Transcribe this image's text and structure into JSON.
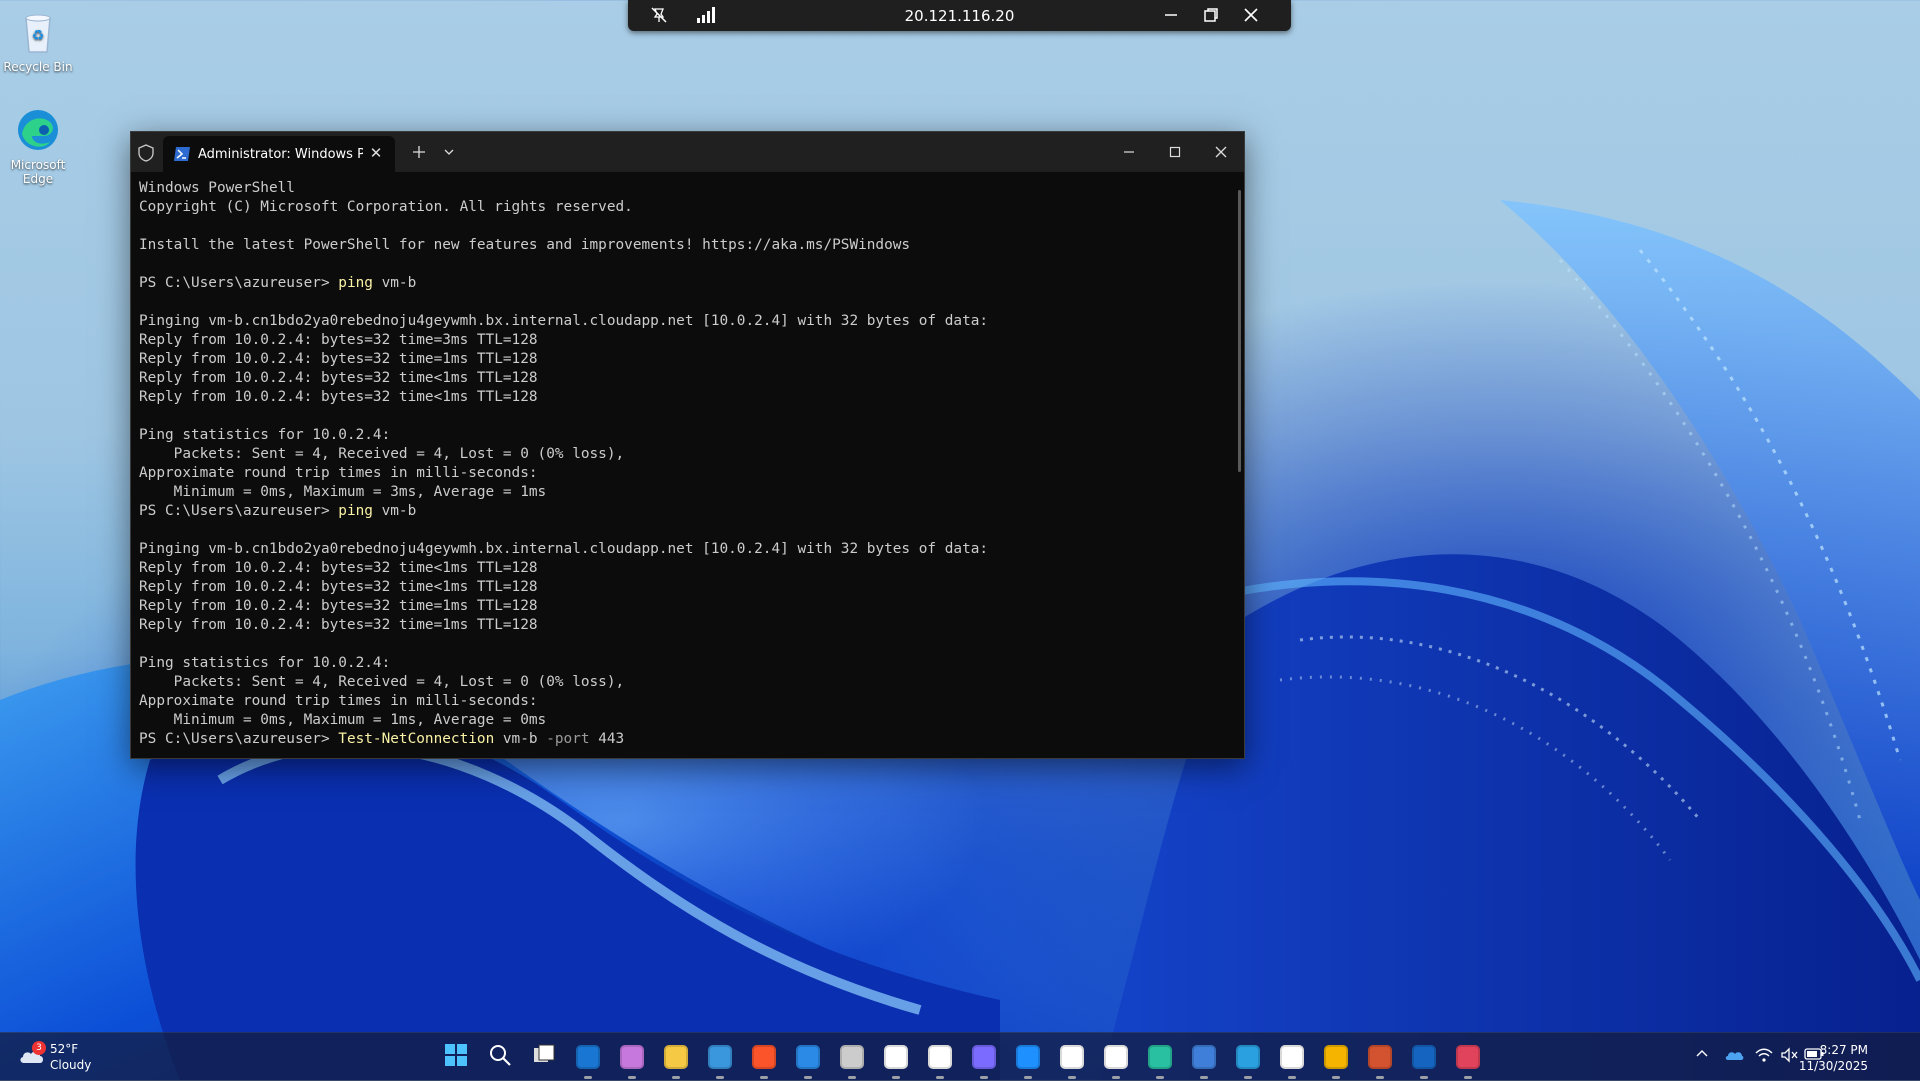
{
  "desktop": {
    "icons": [
      {
        "label": "Recycle Bin"
      },
      {
        "label": "Microsoft Edge"
      }
    ]
  },
  "rdp_bar": {
    "address": "20.121.116.20",
    "icons": [
      "unpin-icon",
      "signal-strength-icon",
      "minimize-icon",
      "restore-icon",
      "close-icon"
    ]
  },
  "terminal": {
    "tab_title": "Administrator: Windows Powe",
    "lines": [
      {
        "t": "Windows PowerShell"
      },
      {
        "t": "Copyright (C) Microsoft Corporation. All rights reserved."
      },
      {
        "t": ""
      },
      {
        "t": "Install the latest PowerShell for new features and improvements! https://aka.ms/PSWindows"
      },
      {
        "t": ""
      },
      {
        "prompt": "PS C:\\Users\\azureuser> ",
        "cmd": "ping",
        "args": " vm-b"
      },
      {
        "t": ""
      },
      {
        "t": "Pinging vm-b.cn1bdo2ya0rebednoju4geywmh.bx.internal.cloudapp.net [10.0.2.4] with 32 bytes of data:"
      },
      {
        "t": "Reply from 10.0.2.4: bytes=32 time=3ms TTL=128"
      },
      {
        "t": "Reply from 10.0.2.4: bytes=32 time=1ms TTL=128"
      },
      {
        "t": "Reply from 10.0.2.4: bytes=32 time<1ms TTL=128"
      },
      {
        "t": "Reply from 10.0.2.4: bytes=32 time<1ms TTL=128"
      },
      {
        "t": ""
      },
      {
        "t": "Ping statistics for 10.0.2.4:"
      },
      {
        "t": "    Packets: Sent = 4, Received = 4, Lost = 0 (0% loss),"
      },
      {
        "t": "Approximate round trip times in milli-seconds:"
      },
      {
        "t": "    Minimum = 0ms, Maximum = 3ms, Average = 1ms"
      },
      {
        "prompt": "PS C:\\Users\\azureuser> ",
        "cmd": "ping",
        "args": " vm-b"
      },
      {
        "t": ""
      },
      {
        "t": "Pinging vm-b.cn1bdo2ya0rebednoju4geywmh.bx.internal.cloudapp.net [10.0.2.4] with 32 bytes of data:"
      },
      {
        "t": "Reply from 10.0.2.4: bytes=32 time<1ms TTL=128"
      },
      {
        "t": "Reply from 10.0.2.4: bytes=32 time<1ms TTL=128"
      },
      {
        "t": "Reply from 10.0.2.4: bytes=32 time=1ms TTL=128"
      },
      {
        "t": "Reply from 10.0.2.4: bytes=32 time=1ms TTL=128"
      },
      {
        "t": ""
      },
      {
        "t": "Ping statistics for 10.0.2.4:"
      },
      {
        "t": "    Packets: Sent = 4, Received = 4, Lost = 0 (0% loss),"
      },
      {
        "t": "Approximate round trip times in milli-seconds:"
      },
      {
        "t": "    Minimum = 0ms, Maximum = 1ms, Average = 0ms"
      },
      {
        "prompt": "PS C:\\Users\\azureuser> ",
        "cmd": "Test-NetConnection",
        "args": " vm-b ",
        "param": "-port",
        "rest": " 443"
      }
    ]
  },
  "taskbar": {
    "weather": {
      "temp": "52°F",
      "condition": "Cloudy",
      "badge": "3"
    },
    "clock": {
      "time": "8:27 PM",
      "date": "11/30/2025"
    },
    "apps": [
      {
        "name": "start",
        "color": "#3aa0f0"
      },
      {
        "name": "search",
        "color": "#ffffff"
      },
      {
        "name": "task-view",
        "color": "#ffffff"
      },
      {
        "name": "outlook",
        "color": "#1976d2"
      },
      {
        "name": "copilot",
        "color": "#c678dd"
      },
      {
        "name": "file-explorer",
        "color": "#f6c945"
      },
      {
        "name": "microsoft-store",
        "color": "#3a96dd"
      },
      {
        "name": "brave",
        "color": "#fb542b"
      },
      {
        "name": "vs-code",
        "color": "#2a8ae6"
      },
      {
        "name": "terminal",
        "color": "#cccccc"
      },
      {
        "name": "chatgpt",
        "color": "#ffffff"
      },
      {
        "name": "notion",
        "color": "#ffffff"
      },
      {
        "name": "cortana",
        "color": "#7b6cff"
      },
      {
        "name": "app-blue",
        "color": "#1e90ff"
      },
      {
        "name": "tiktok",
        "color": "#ffffff"
      },
      {
        "name": "app-white",
        "color": "#ffffff"
      },
      {
        "name": "edge",
        "color": "#28c0a0"
      },
      {
        "name": "powershell",
        "color": "#3f7fd9"
      },
      {
        "name": "visual-studio",
        "color": "#2aa0e0"
      },
      {
        "name": "github",
        "color": "#ffffff"
      },
      {
        "name": "chrome",
        "color": "#f4b400"
      },
      {
        "name": "powerpoint",
        "color": "#d35230"
      },
      {
        "name": "remote-desktop",
        "color": "#1565c0"
      },
      {
        "name": "snipping-tool",
        "color": "#e0435b"
      }
    ]
  }
}
